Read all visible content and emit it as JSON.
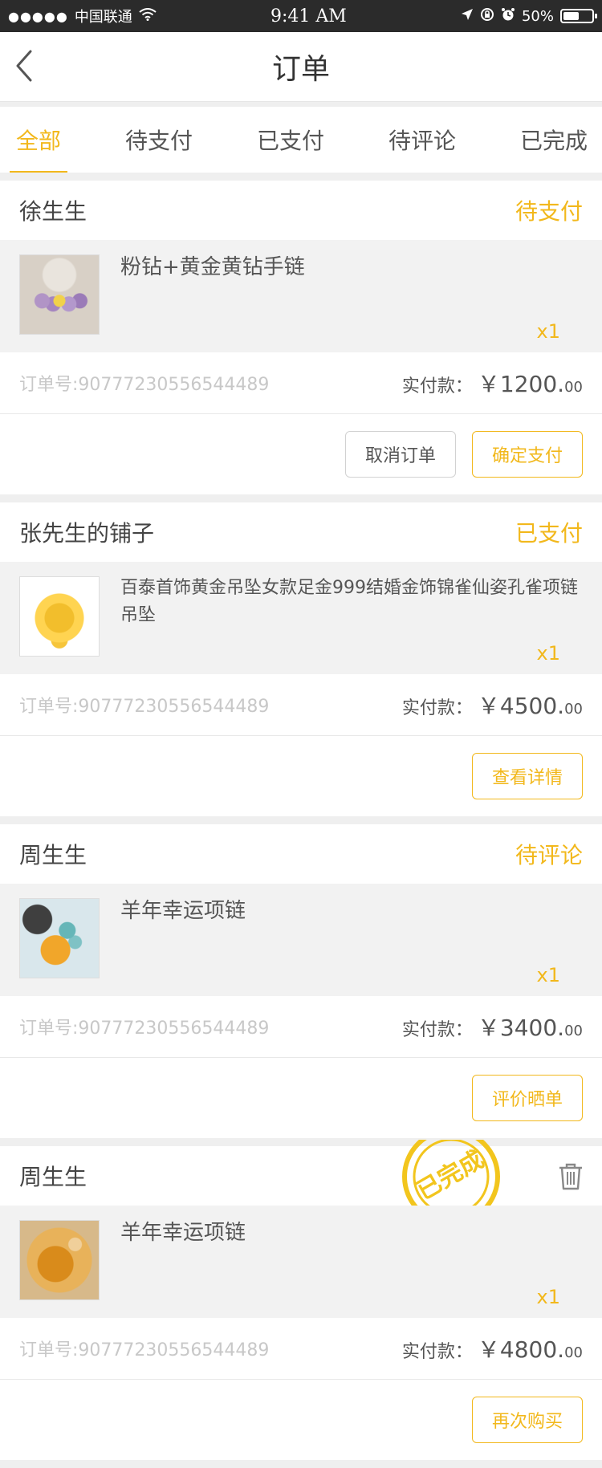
{
  "status_bar": {
    "carrier": "中国联通",
    "time": "9:41 AM",
    "battery": "50%"
  },
  "nav": {
    "title": "订单"
  },
  "tabs": [
    {
      "label": "全部",
      "active": true
    },
    {
      "label": "待支付",
      "active": false
    },
    {
      "label": "已支付",
      "active": false
    },
    {
      "label": "待评论",
      "active": false
    },
    {
      "label": "已完成",
      "active": false
    }
  ],
  "orders": [
    {
      "shop": "徐生生",
      "status": "待支付",
      "item_title": "粉钻+黄金黄钻手链",
      "qty": "x1",
      "order_no": "订单号:90777230556544489",
      "paid_label": "实付款：",
      "amount": "￥1200.",
      "cents": "00",
      "buttons": [
        "取消订单",
        "确定支付"
      ]
    },
    {
      "shop": "张先生的铺子",
      "status": "已支付",
      "item_title": "百泰首饰黄金吊坠女款足金999结婚金饰锦雀仙姿孔雀项链吊坠",
      "qty": "x1",
      "order_no": "订单号:90777230556544489",
      "paid_label": "实付款：",
      "amount": "￥4500.",
      "cents": "00",
      "buttons": [
        "查看详情"
      ]
    },
    {
      "shop": "周生生",
      "status": "待评论",
      "item_title": "羊年幸运项链",
      "qty": "x1",
      "order_no": "订单号:90777230556544489",
      "paid_label": "实付款：",
      "amount": "￥3400.",
      "cents": "00",
      "buttons": [
        "评价晒单"
      ]
    },
    {
      "shop": "周生生",
      "stamp_text": "已完成",
      "item_title": "羊年幸运项链",
      "qty": "x1",
      "order_no": "订单号:90777230556544489",
      "paid_label": "实付款：",
      "amount": "￥4800.",
      "cents": "00",
      "buttons": [
        "再次购买"
      ]
    }
  ],
  "colors": {
    "accent": "#f2b81c",
    "status_bar_bg": "#2b2b2b",
    "page_bg": "#efefef"
  },
  "icons": [
    "signal-dots-icon",
    "wifi-icon",
    "location-arrow-icon",
    "rotation-lock-icon",
    "alarm-icon",
    "battery-icon",
    "back-chevron-icon",
    "trash-icon"
  ]
}
